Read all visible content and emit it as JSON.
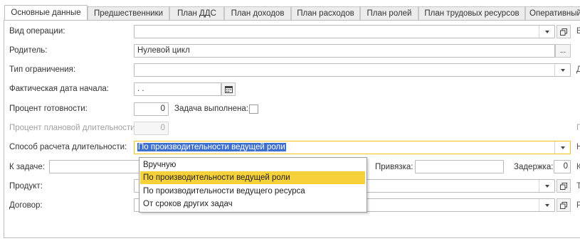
{
  "tabs": [
    {
      "label": "Основные данные"
    },
    {
      "label": "Предшественники"
    },
    {
      "label": "План ДДС"
    },
    {
      "label": "План доходов"
    },
    {
      "label": "План расходов"
    },
    {
      "label": "План ролей"
    },
    {
      "label": "План трудовых ресурсов"
    },
    {
      "label": "Оперативный"
    }
  ],
  "form": {
    "operation_type_label": "Вид операции:",
    "operation_type_value": "",
    "parent_label": "Родитель:",
    "parent_value": "Нулевой цикл",
    "parent_button": "...",
    "limit_type_label": "Тип ограничения:",
    "limit_type_value": "",
    "actual_start_label": "Фактическая дата начала:",
    "actual_start_value": " .  .",
    "readiness_label": "Процент готовности:",
    "readiness_value": "0",
    "task_done_label": "Задача выполнена:",
    "planned_duration_label": "Процент плановой длительности:",
    "planned_duration_value": "0",
    "duration_method_label": "Способ расчета длительности:",
    "duration_method_value": "По производительности ведущей роли",
    "to_task_label": "К задаче:",
    "binding_label": "Привязка:",
    "delay_label": "Задержка:",
    "delay_value": "0",
    "product_label": "Продукт:",
    "contract_label": "Договор:"
  },
  "edge_letters": [
    "В",
    "Д",
    "П",
    "Н",
    "К",
    "Т",
    "Р"
  ],
  "dropdown": {
    "items": [
      {
        "label": "Вручную"
      },
      {
        "label": "По производительности ведущей роли"
      },
      {
        "label": "По производительности ведущего ресурса"
      },
      {
        "label": "От сроков других задач"
      }
    ],
    "selected_index": 1
  },
  "colors": {
    "focus_border": "#f2c11d",
    "selected_item": "#f7d139",
    "text_selection": "#3d6fce"
  }
}
